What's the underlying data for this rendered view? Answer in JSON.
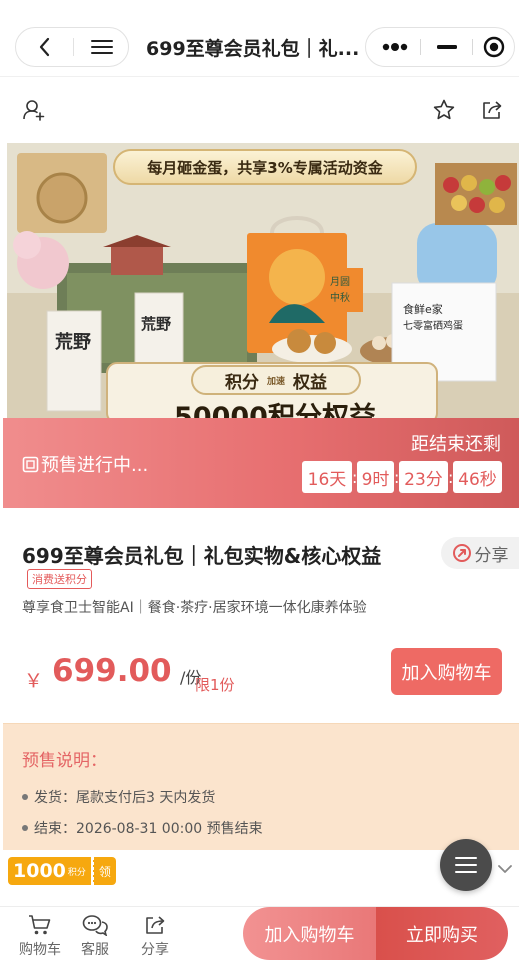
{
  "app": {
    "page_title": "699至尊会员礼包｜礼..."
  },
  "banner": {
    "headline": "每月砸金蛋，共享3%专属活动资金",
    "mid_left": "积分",
    "mid_sep": "加速",
    "mid_right": "权益",
    "big_text": "50000积分权益",
    "box_label_1": "月圆中秋",
    "box_label_2": "食鲜e家 七零富硒鸡蛋",
    "tea_brand": "荒野"
  },
  "countdown": {
    "status": "预售进行中...",
    "label": "距结束还剩",
    "days": "16天",
    "hours": "9时",
    "minutes": "23分",
    "seconds": "46秒"
  },
  "product": {
    "title": "699至尊会员礼包｜礼包实物&核心权益",
    "share_label": "分享",
    "points_tag": "消费送积分",
    "subtitle": "尊享食卫士智能AI｜餐食·茶疗·居家环境一体化康养体验",
    "currency_symbol": "￥",
    "price": "699.00",
    "unit": "/份",
    "limit": "限1份",
    "add_to_cart": "加入购物车"
  },
  "notes": {
    "title": "预售说明：",
    "items": [
      "发货：尾款支付后3 天内发货",
      "结束：2026-08-31 00:00 预售结束"
    ]
  },
  "coupon": {
    "amount": "1000",
    "unit": "积分",
    "claim": "领"
  },
  "bottom_bar": {
    "cart": "购物车",
    "service": "客服",
    "share": "分享",
    "add_to_cart": "加入购物车",
    "buy_now": "立即购买"
  },
  "icons": {
    "back": "chevron-left-icon",
    "home": "menu-icon",
    "more": "more-dots-icon",
    "minimize": "minimize-icon",
    "close": "record-circle-icon",
    "follow": "add-user-icon",
    "favorite": "star-icon",
    "share": "share-icon",
    "cart": "cart-icon",
    "service": "chat-icon"
  },
  "colors": {
    "accent_red": "#e25b5b",
    "countdown_start": "#f08d8d",
    "countdown_end": "#cf5a5a",
    "notes_bg": "#fbe4cd",
    "coupon_orange": "#f6a80f",
    "buy_now": "#d9504b",
    "add_to_cart": "#ee6a64"
  }
}
